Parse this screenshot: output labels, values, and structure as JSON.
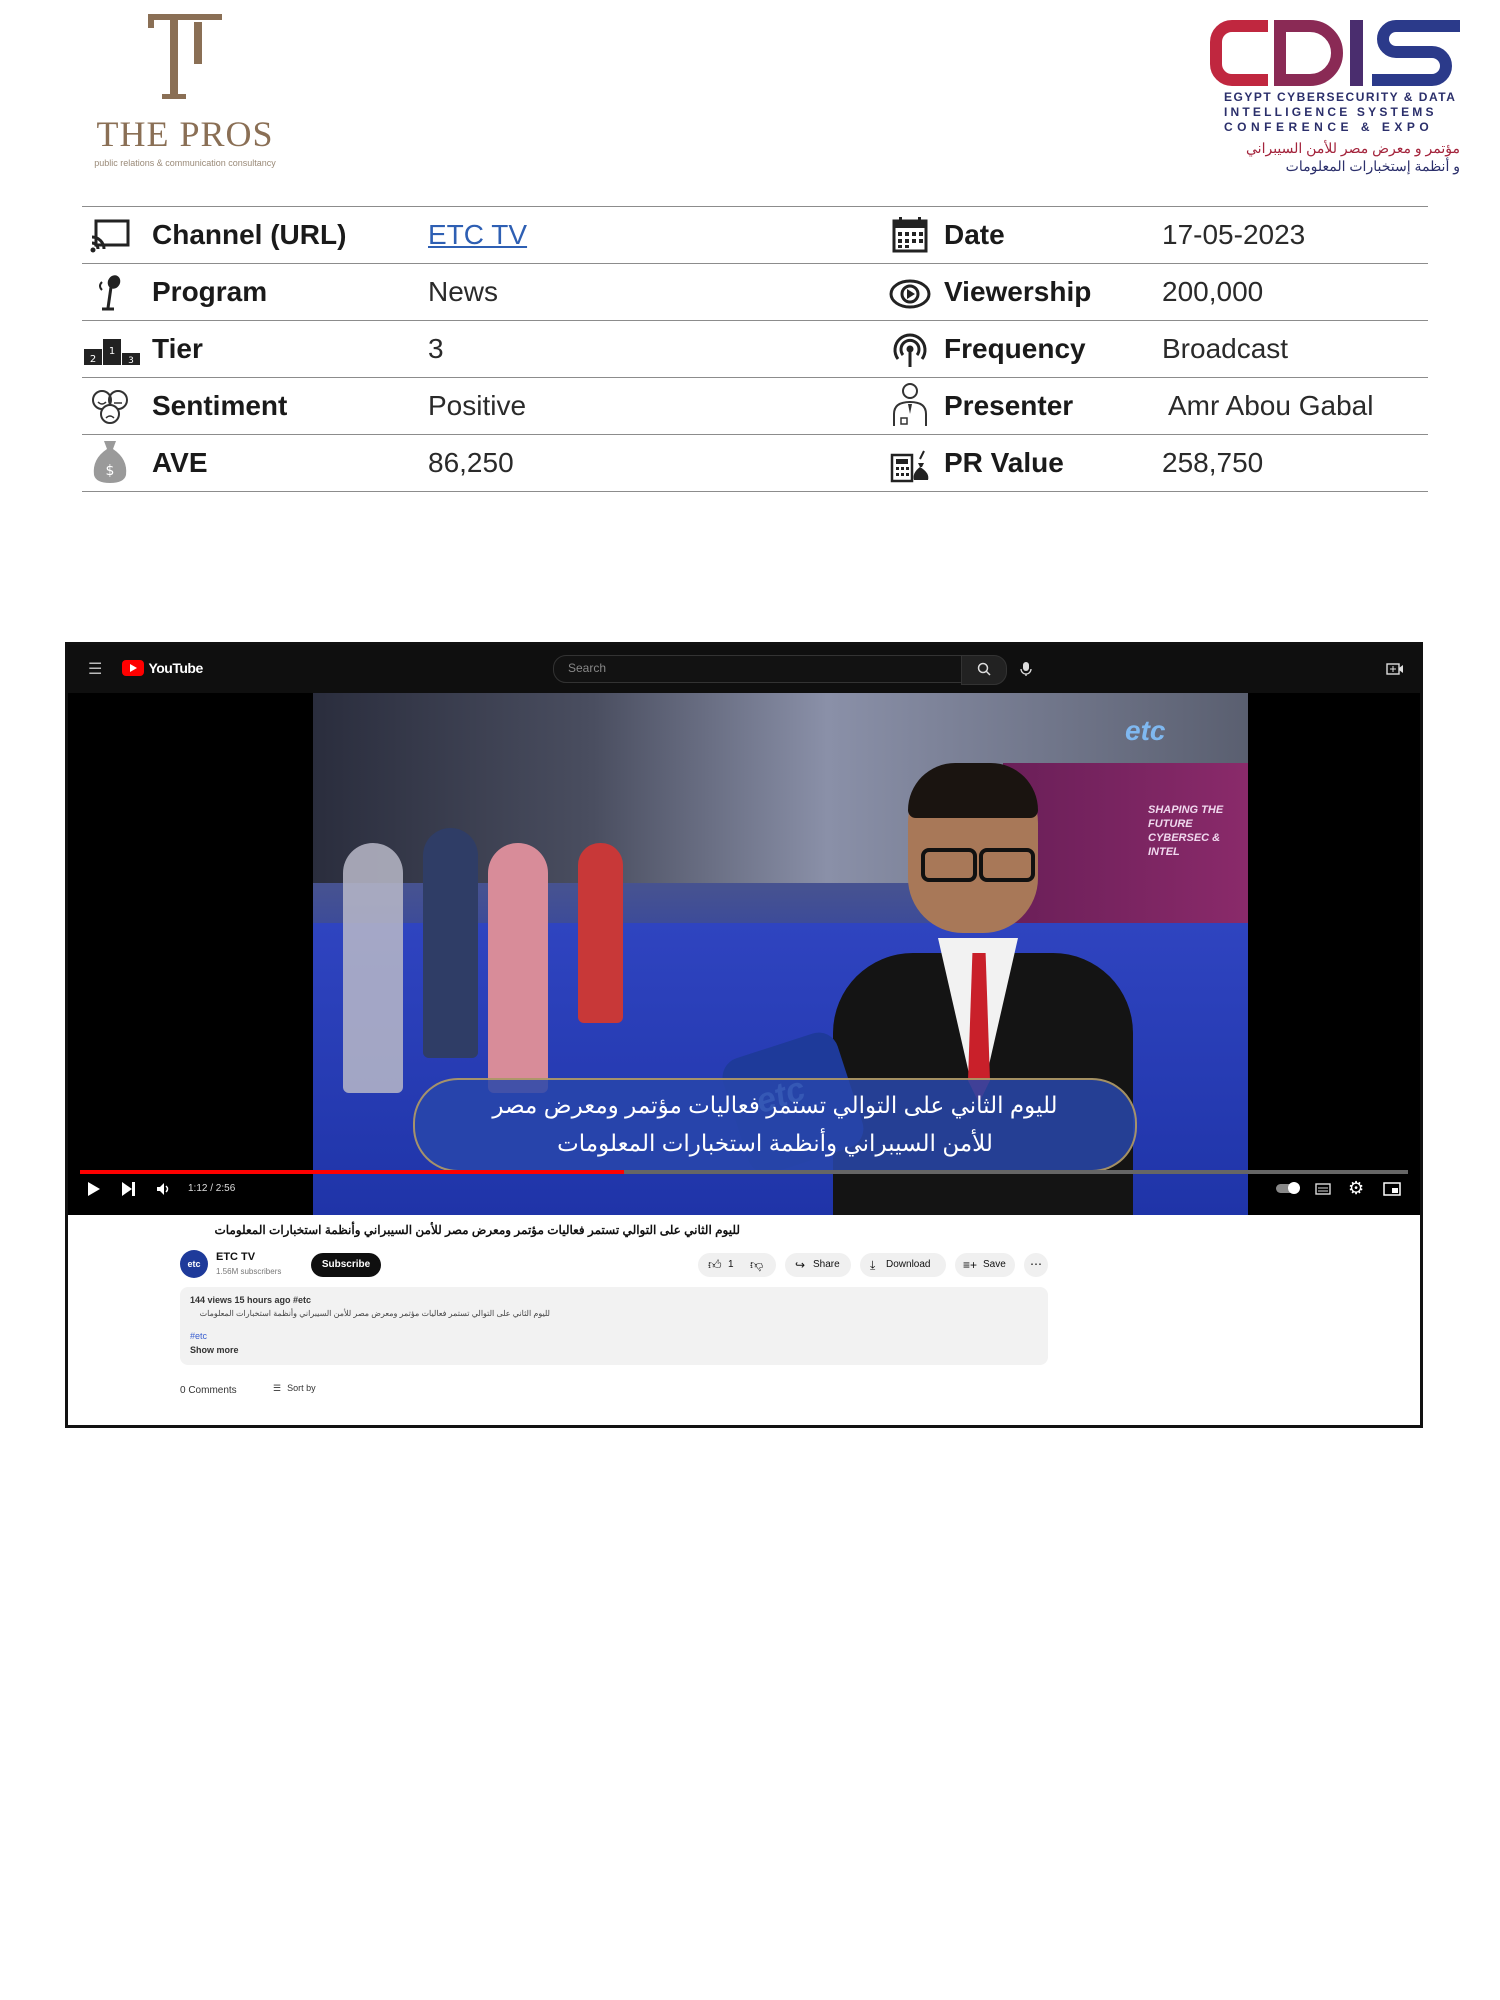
{
  "header": {
    "left_logo": {
      "name": "THE PROS",
      "tagline": "public relations & communication consultancy"
    },
    "right_logo": {
      "wordmark": "CDIS",
      "line1": "EGYPT CYBERSECURITY & DATA",
      "line2": "INTELLIGENCE SYSTEMS",
      "line3": "CONFERENCE & EXPO",
      "arabic1": "مؤتمر و معرض مصر للأمن السيبراني",
      "arabic2": "و أنظمة إستخبارات المعلومات",
      "colors": {
        "red": "#c0273f",
        "navy": "#2b2f6b"
      }
    }
  },
  "info": {
    "rows": [
      {
        "left": {
          "icon": "cast-icon",
          "label": "Channel (URL)",
          "value": "ETC TV"
        },
        "right": {
          "icon": "calendar-icon",
          "label": "Date",
          "value": "17-05-2023"
        }
      },
      {
        "left": {
          "icon": "microphone-icon",
          "label": "Program",
          "value": "News"
        },
        "right": {
          "icon": "eye-icon",
          "label": "Viewership",
          "value": "200,000"
        }
      },
      {
        "left": {
          "icon": "podium-icon",
          "label": "Tier",
          "value": "3"
        },
        "right": {
          "icon": "broadcast-icon",
          "label": "Frequency",
          "value": "Broadcast"
        }
      },
      {
        "left": {
          "icon": "faces-icon",
          "label": "Sentiment",
          "value": "Positive"
        },
        "right": {
          "icon": "presenter-icon",
          "label": "Presenter",
          "value": "Amr Abou Gabal"
        }
      },
      {
        "left": {
          "icon": "money-bag-icon",
          "label": "AVE",
          "value": "86,250"
        },
        "right": {
          "icon": "calculator-icon",
          "label": "PR Value",
          "value": "258,750"
        }
      }
    ]
  },
  "youtube": {
    "logo": "YouTube",
    "search_placeholder": "Search",
    "caption_line1": "لليوم الثاني على التوالي تستمر فعاليات مؤتمر ومعرض مصر",
    "caption_line2": "للأمن السيبراني وأنظمة استخبارات المعلومات",
    "time": "1:12 / 2:56",
    "progress": 0.41,
    "video_title": "لليوم الثاني على التوالي تستمر فعاليات مؤتمر ومعرض مصر للأمن السيبراني وأنظمة استخبارات المعلومات",
    "channel": "ETC TV",
    "subscribers": "1.56M subscribers",
    "subscribe": "Subscribe",
    "like_count": "1",
    "share": "Share",
    "download": "Download",
    "save": "Save",
    "description": {
      "meta": "144 views  15 hours ago  #etc",
      "text": "لليوم الثاني على التوالي تستمر فعاليات مؤتمر ومعرض مصر للأمن السيبراني وأنظمة استخبارات المعلومات",
      "hashtag": "#etc",
      "show_more": "Show more"
    },
    "comments": "0 Comments",
    "sort_by": "Sort by",
    "frame_logo": "etc",
    "backdrop_text": "SHAPING THE FUTURE CYBERSEC & INTEL"
  }
}
